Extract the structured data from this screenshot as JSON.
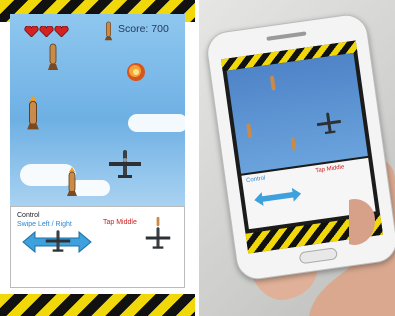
{
  "game": {
    "score_label": "Score: 700",
    "lives": 3
  },
  "controls": {
    "title": "Control",
    "swipe": "Swipe Left / Right",
    "tap": "Tap Middle"
  },
  "phone_screen": {
    "title": "Control",
    "tap": "Tap Middle"
  },
  "colors": {
    "sky": "#7ab9e8",
    "hazard_yellow": "#f1d80a",
    "hazard_black": "#111111",
    "swipe_text": "#2d86d0",
    "tap_text": "#cc2020"
  },
  "icons": [
    "heart-icon",
    "missile-icon",
    "fighter-plane-icon",
    "explosion-icon",
    "double-arrow-icon"
  ]
}
